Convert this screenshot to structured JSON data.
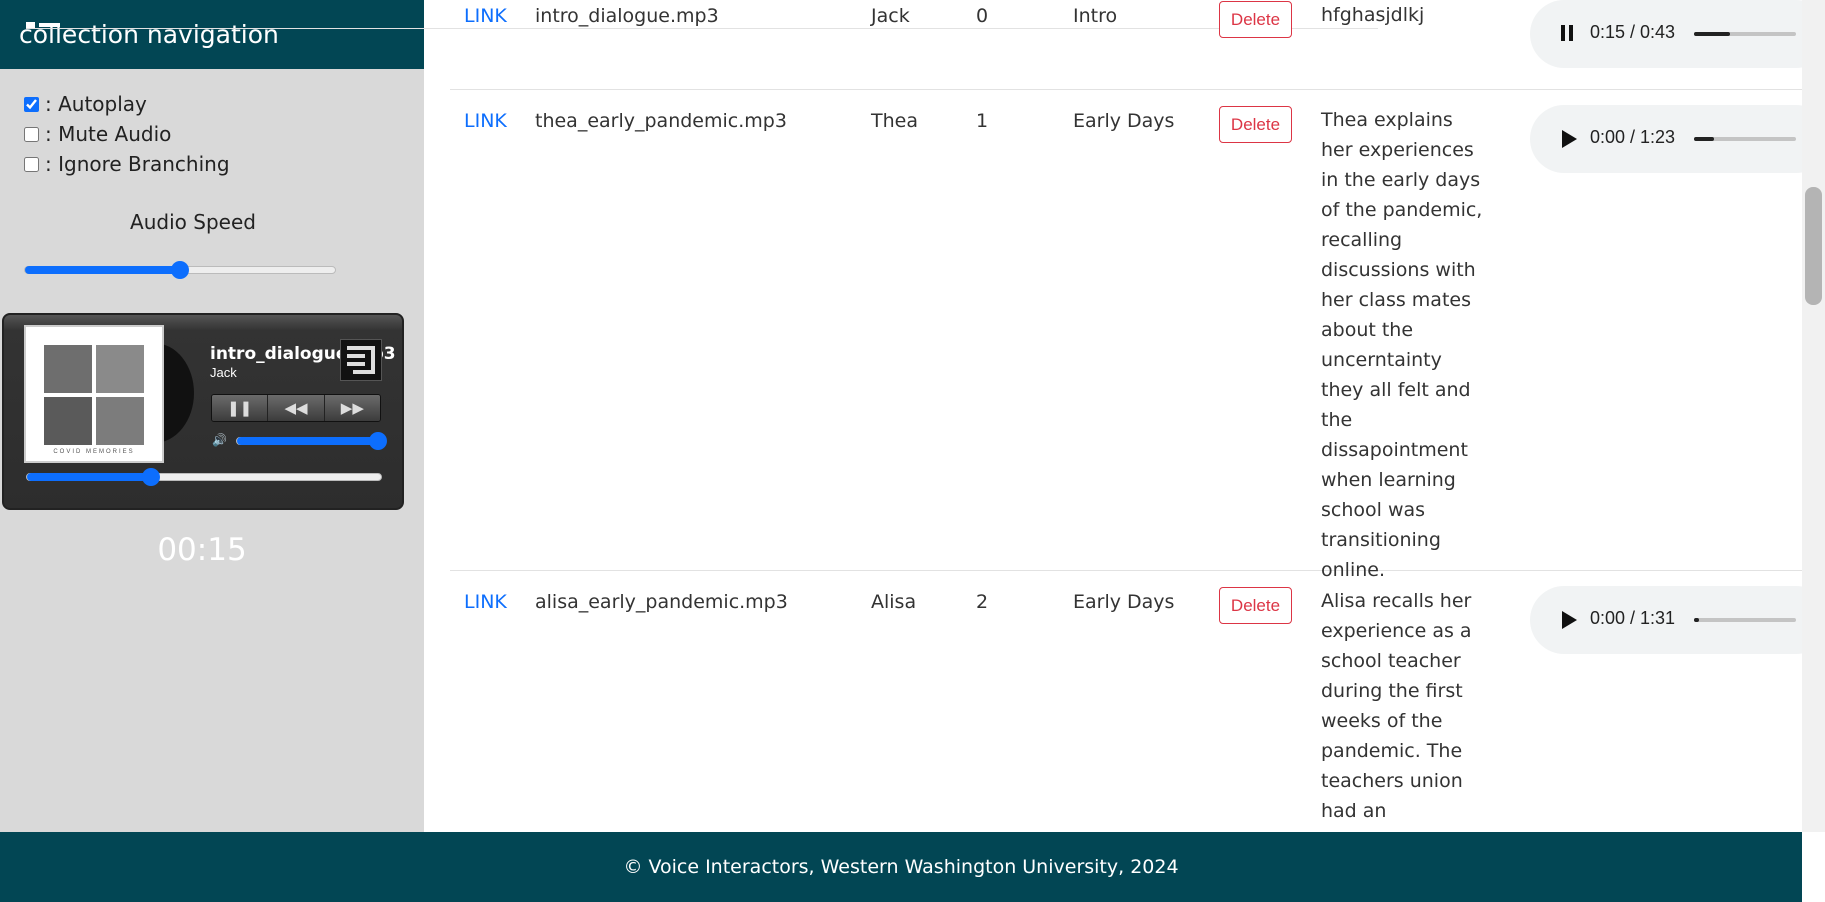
{
  "sidebar": {
    "title": "collection navigation",
    "options": [
      {
        "label": ": Autoplay",
        "checked": true
      },
      {
        "label": ": Mute Audio",
        "checked": false
      },
      {
        "label": ": Ignore Branching",
        "checked": false
      }
    ],
    "audio_speed_label": "Audio Speed",
    "audio_speed_fraction": 0.5
  },
  "player": {
    "track_name": "intro_dialogue.mp3",
    "artist": "Jack",
    "cover_caption": "COVID MEMORIES",
    "volume_fraction": 1.0,
    "progress_fraction": 0.35,
    "time_display": "00:15",
    "controls": [
      "pause",
      "rewind",
      "fast-forward"
    ]
  },
  "rows": [
    {
      "link": "LINK",
      "file": "intro_dialogue.mp3",
      "speaker": "Jack",
      "index": "0",
      "category": "Intro",
      "delete_label": "Delete",
      "description": "hfghasjdlkj",
      "audio_time": "0:15 / 0:43",
      "audio_progress": 0.35,
      "playing": true
    },
    {
      "link": "LINK",
      "file": "thea_early_pandemic.mp3",
      "speaker": "Thea",
      "index": "1",
      "category": "Early Days",
      "delete_label": "Delete",
      "description": "Thea explains her experiences in the early days of the pandemic, recalling discussions with her class mates about the uncerntainty they all felt and the dissapointment when learning school was transitioning online.",
      "audio_time": "0:00 / 1:23",
      "audio_progress": 0.2,
      "playing": false
    },
    {
      "link": "LINK",
      "file": "alisa_early_pandemic.mp3",
      "speaker": "Alisa",
      "index": "2",
      "category": "Early Days",
      "delete_label": "Delete",
      "description": "Alisa recalls her experience as a school teacher during the first weeks of the pandemic. The teachers union had an",
      "audio_time": "0:00 / 1:31",
      "audio_progress": 0.05,
      "playing": false
    }
  ],
  "footer": {
    "text": "© Voice Interactors, Western Washington University, 2024"
  },
  "colors": {
    "header_bg": "#024654",
    "sidebar_bg": "#d9d9d9",
    "accent": "#0d6efd",
    "danger": "#dc3545"
  }
}
